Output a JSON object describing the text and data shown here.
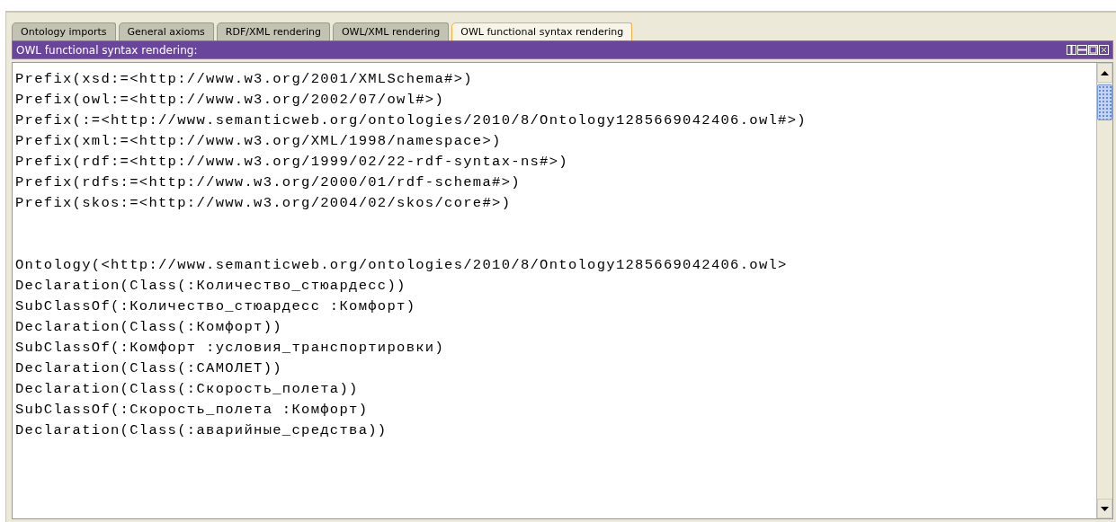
{
  "tabs": [
    {
      "label": "Ontology imports",
      "selected": false
    },
    {
      "label": "General axioms",
      "selected": false
    },
    {
      "label": "RDF/XML rendering",
      "selected": false
    },
    {
      "label": "OWL/XML rendering",
      "selected": false
    },
    {
      "label": "OWL functional syntax rendering",
      "selected": true
    }
  ],
  "panel": {
    "title": "OWL functional syntax rendering:"
  },
  "prefixes": [
    "Prefix(xsd:=<http://www.w3.org/2001/XMLSchema#>)",
    "Prefix(owl:=<http://www.w3.org/2002/07/owl#>)",
    "Prefix(:=<http://www.semanticweb.org/ontologies/2010/8/Ontology1285669042406.owl#>)",
    "Prefix(xml:=<http://www.w3.org/XML/1998/namespace>)",
    "Prefix(rdf:=<http://www.w3.org/1999/02/22-rdf-syntax-ns#>)",
    "Prefix(rdfs:=<http://www.w3.org/2000/01/rdf-schema#>)",
    "Prefix(skos:=<http://www.w3.org/2004/02/skos/core#>)"
  ],
  "axioms": [
    "Ontology(<http://www.semanticweb.org/ontologies/2010/8/Ontology1285669042406.owl>",
    "Declaration(Class(:Количество_стюардесс))",
    "SubClassOf(:Количество_стюардесс :Комфорт)",
    "Declaration(Class(:Комфорт))",
    "SubClassOf(:Комфорт :условия_транспортировки)",
    "Declaration(Class(:САМОЛЕТ))",
    "Declaration(Class(:Скорость_полета))",
    "SubClassOf(:Скорость_полета :Комфорт)",
    "Declaration(Class(:аварийные_средства))"
  ]
}
